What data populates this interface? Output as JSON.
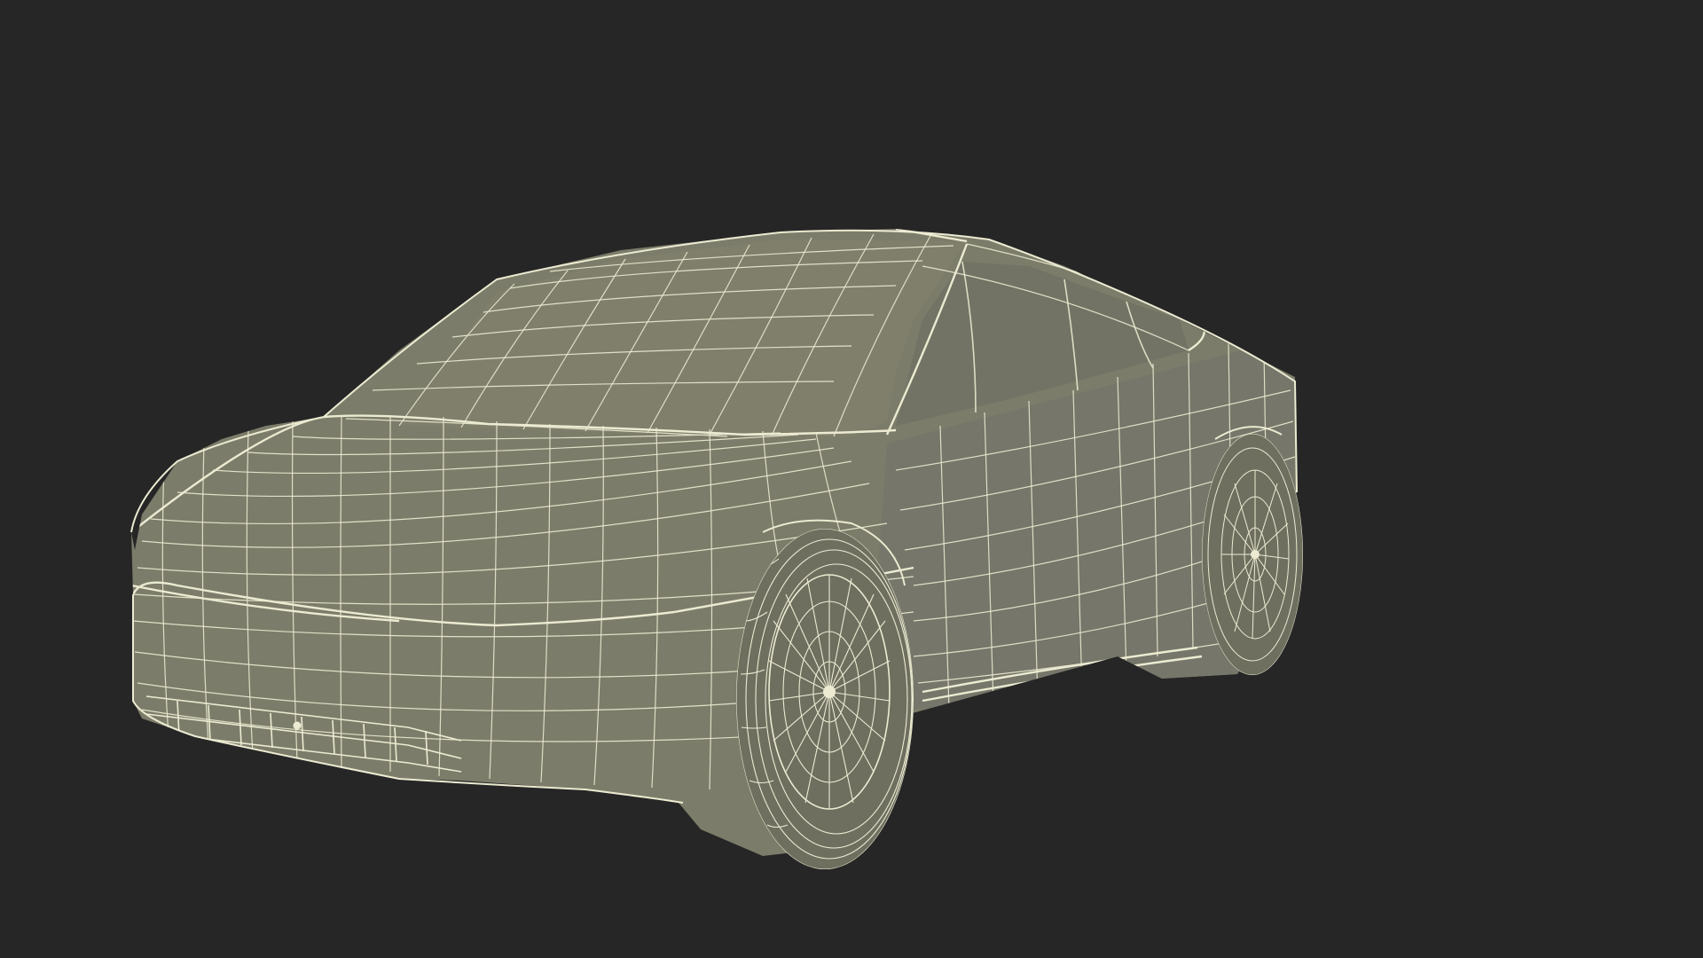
{
  "scene": {
    "background_color": "#262626",
    "body_color": "#7c7c6a",
    "body_shade_color": "#6c6c5c",
    "tire_color": "#6f6f60",
    "wire_color": "#ecebd2",
    "subject": "car-wireframe-model"
  }
}
